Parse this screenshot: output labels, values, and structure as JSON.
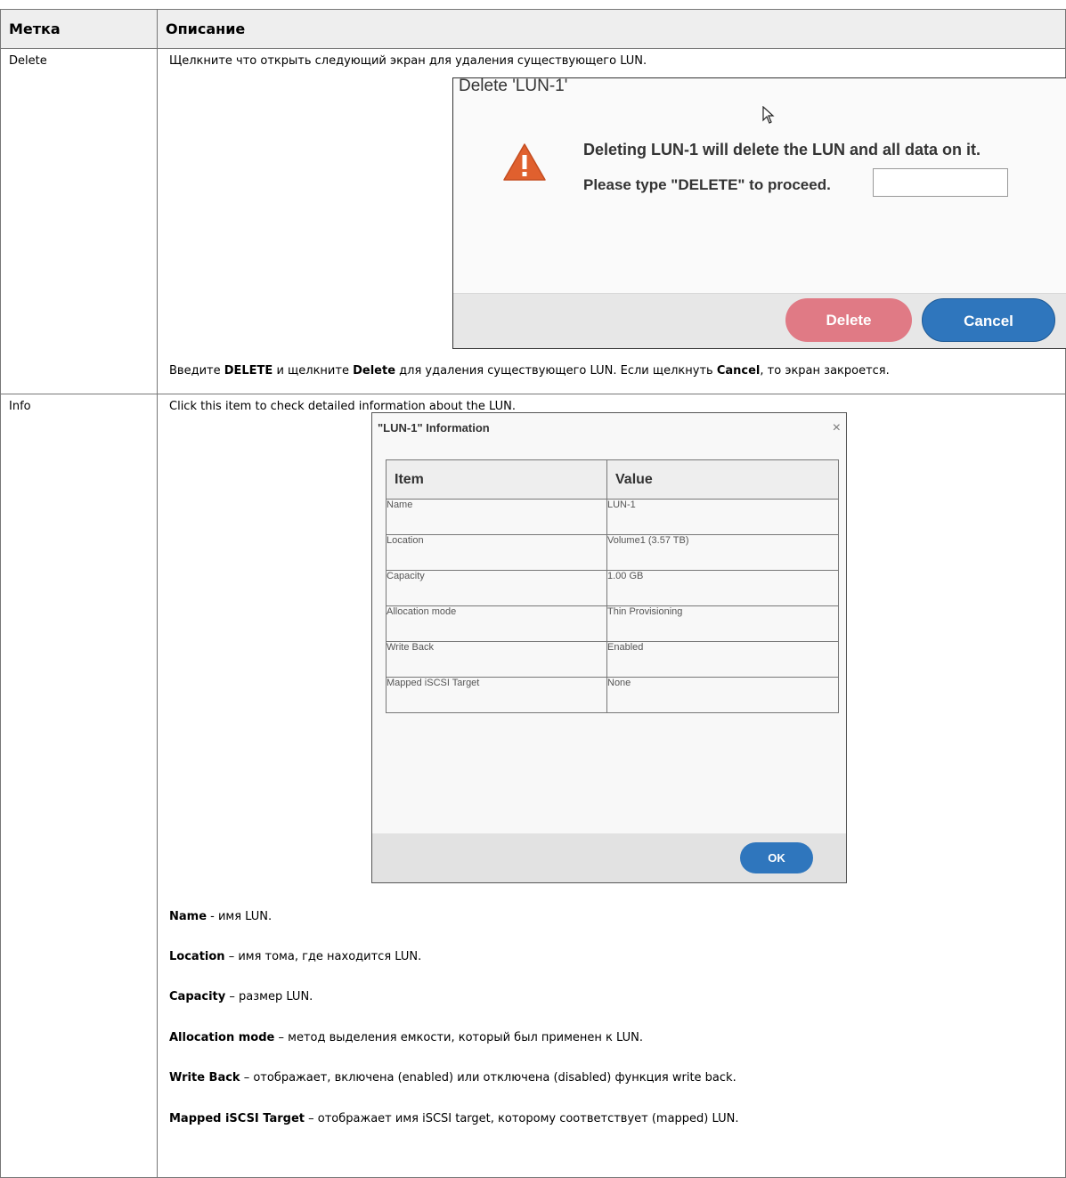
{
  "top_text": "   ...   ",
  "table": {
    "headers": [
      "Метка",
      "Описание"
    ],
    "rows": {
      "delete": {
        "label": "Delete",
        "intro": "Щелкните что открыть следующий экран для удаления существующего LUN.",
        "dialog": {
          "title": "Delete 'LUN-1'",
          "close": "×",
          "message1": "Deleting LUN-1 will delete the LUN and all data on it.",
          "message2": "Please type \"DELETE\" to proceed.",
          "input_value": "",
          "delete_button": "Delete",
          "cancel_button": "Cancel"
        },
        "note": {
          "p1": "Введите ",
          "b1": "DELETE",
          "p2": " и щелкните ",
          "b2": "Delete",
          "p3": " для удаления существующего LUN. Если щелкнуть ",
          "b3": "Cancel",
          "p4": ", то экран закроется."
        }
      },
      "info": {
        "label": "Info",
        "intro": "Click this item to check detailed information about the LUN.",
        "dialog": {
          "title": "\"LUN-1\" Information",
          "close": "×",
          "col_item": "Item",
          "col_value": "Value",
          "rows": [
            {
              "item": "Name",
              "value": "LUN-1"
            },
            {
              "item": "Location",
              "value": "Volume1 (3.57 TB)"
            },
            {
              "item": "Capacity",
              "value": "1.00 GB"
            },
            {
              "item": "Allocation mode",
              "value": "Thin Provisioning"
            },
            {
              "item": "Write Back",
              "value": "Enabled"
            },
            {
              "item": "Mapped iSCSI Target",
              "value": "None"
            }
          ],
          "ok_button": "OK"
        },
        "definitions": [
          {
            "term": "Name",
            "text": " - имя LUN."
          },
          {
            "term": "Location",
            "text": " – имя тома, где находится LUN."
          },
          {
            "term": "Capacity",
            "text": " – размер LUN."
          },
          {
            "term": "Allocation mode",
            "text": " – метод выделения емкости, который был применен к LUN."
          },
          {
            "term": "Write Back",
            "text": " – отображает, включена (enabled) или отключена (disabled) функция write back."
          },
          {
            "term": "Mapped iSCSI Target",
            "text": " – отображает имя iSCSI target, которому соответствует (mapped) LUN."
          }
        ]
      }
    }
  },
  "colors": {
    "warning": "#e0602e",
    "delete_button": "#e07a85",
    "cancel_button": "#2f76bd",
    "ok_button": "#2f76bd"
  }
}
